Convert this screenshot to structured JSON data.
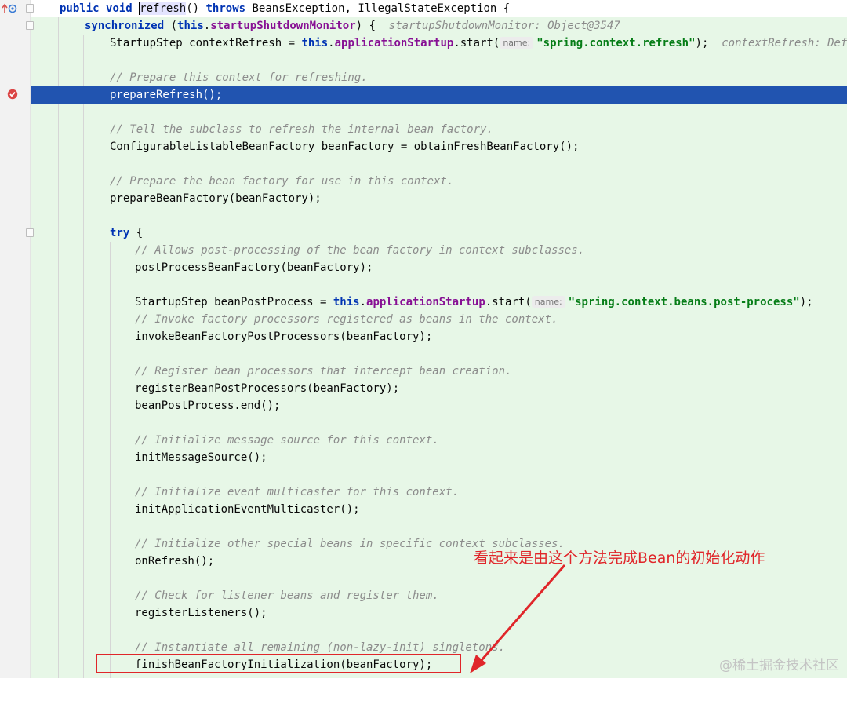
{
  "code": {
    "line1": {
      "kw1": "public",
      "kw2": "void",
      "name_pre": "r",
      "name_post": "efresh",
      "paren": "()",
      "kw3": "throws",
      "rest": "BeansException, IllegalStateException {"
    },
    "line2": {
      "kw": "synchronized",
      "open": "(",
      "this": "this",
      "dot": ".",
      "field": "startupShutdownMonitor",
      "close": ") {",
      "inline": "startupShutdownMonitor: Object@3547"
    },
    "line3": {
      "pre": "StartupStep contextRefresh = ",
      "this": "this",
      "dot": ".",
      "field": "applicationStartup",
      "call": ".start(",
      "hint": "name:",
      "str": "\"spring.context.refresh\"",
      "end": ");",
      "inline": "contextRefresh: DefaultA"
    },
    "line5": "// Prepare this context for refreshing.",
    "line6": "prepareRefresh();",
    "line8": "// Tell the subclass to refresh the internal bean factory.",
    "line9": "ConfigurableListableBeanFactory beanFactory = obtainFreshBeanFactory();",
    "line11": "// Prepare the bean factory for use in this context.",
    "line12": "prepareBeanFactory(beanFactory);",
    "line14": {
      "kw": "try",
      "rest": " {"
    },
    "line15": "// Allows post-processing of the bean factory in context subclasses.",
    "line16": "postProcessBeanFactory(beanFactory);",
    "line18": {
      "pre": "StartupStep beanPostProcess = ",
      "this": "this",
      "dot": ".",
      "field": "applicationStartup",
      "call": ".start(",
      "hint": "name:",
      "str": "\"spring.context.beans.post-process\"",
      "end": ");"
    },
    "line19": "// Invoke factory processors registered as beans in the context.",
    "line20": "invokeBeanFactoryPostProcessors(beanFactory);",
    "line22": "// Register bean processors that intercept bean creation.",
    "line23": "registerBeanPostProcessors(beanFactory);",
    "line24": "beanPostProcess.end();",
    "line26": "// Initialize message source for this context.",
    "line27": "initMessageSource();",
    "line29": "// Initialize event multicaster for this context.",
    "line30": "initApplicationEventMulticaster();",
    "line32": "// Initialize other special beans in specific context subclasses.",
    "line33": "onRefresh();",
    "line35": "// Check for listener beans and register them.",
    "line36": "registerListeners();",
    "line38": "// Instantiate all remaining (non-lazy-init) singletons.",
    "line39": "finishBeanFactoryInitialization(beanFactory);"
  },
  "annotation": {
    "text": "看起来是由这个方法完成Bean的初始化动作",
    "color": "#e0262a"
  },
  "watermark": "@稀土掘金技术社区",
  "icons": {
    "gutter_top": "override-arrow-icon",
    "gutter_breakpoint": "breakpoint-icon"
  },
  "colors": {
    "keyword": "#0033b3",
    "field": "#871094",
    "string": "#067d17",
    "comment": "#8c8c8c",
    "selection": "#2154b0",
    "editor_bg": "#e7f7e7"
  }
}
